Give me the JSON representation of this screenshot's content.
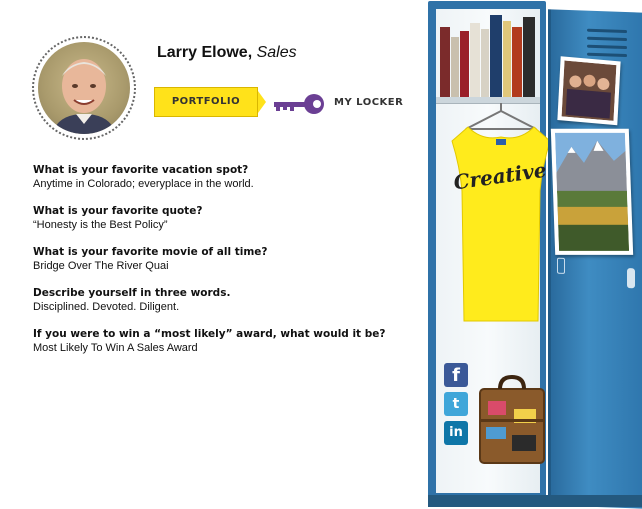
{
  "profile": {
    "name": "Larry Elowe,",
    "role": "Sales",
    "avatar_alt": "profile photo"
  },
  "nav": {
    "portfolio_label": "PORTFOLIO",
    "locker_label": "MY LOCKER",
    "key_icon": "key-icon",
    "accent_color": "#ffe21a",
    "key_color": "#6b3f94"
  },
  "qa": [
    {
      "question": "What is your favorite vacation spot?",
      "answer": "Anytime in Colorado; everyplace in the world."
    },
    {
      "question": "What is your favorite quote?",
      "answer": "“Honesty is the Best Policy”"
    },
    {
      "question": "What is your favorite movie of all time?",
      "answer": "Bridge Over The River Quai"
    },
    {
      "question": "Describe yourself in three words.",
      "answer": "Disciplined. Devoted. Diligent."
    },
    {
      "question": "If you were to win a “most likely” award, what would it be?",
      "answer": "Most Likely To Win A Sales Award"
    }
  ],
  "locker": {
    "shirt_text": "Creative",
    "shirt_color": "#ffeb1c",
    "locker_color": "#2f72a8",
    "social": [
      {
        "name": "facebook-icon",
        "glyph": "f"
      },
      {
        "name": "twitter-icon",
        "glyph": "t"
      },
      {
        "name": "linkedin-icon",
        "glyph": "in"
      }
    ]
  }
}
